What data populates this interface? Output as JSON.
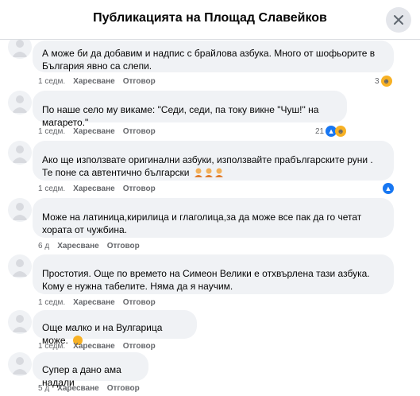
{
  "header": {
    "title": "Публикацията на Площад Славейков"
  },
  "comments": [
    {
      "text": "А може би да добавим и надпис с брайлова азбука. Много от шофьорите в България явно са слепи.",
      "time": "1 седм.",
      "like": "Харесване",
      "reply": "Отговор",
      "reactions": "3",
      "reaction_icons": [
        "haha-icon"
      ]
    },
    {
      "text": "По наше село му викаме: \"Седи, седи, па току викне \"Чуш!\" на магарето.\"",
      "time": "1 седм.",
      "like": "Харесване",
      "reply": "Отговор",
      "reactions": "21",
      "reaction_icons": [
        "like-icon",
        "haha-icon"
      ]
    },
    {
      "text": "Ако ще използвате оригинални азбуки, използвайте прабългарските руни . Те поне са автентично български",
      "time": "1 седм.",
      "like": "Харесване",
      "reply": "Отговор",
      "reactions": "",
      "reaction_icons": [
        "like-icon"
      ]
    },
    {
      "text": "Може на латиница,кирилица и глаголица,за да може все пак да го четат хората от чужбина.",
      "time": "6 д",
      "like": "Харесване",
      "reply": "Отговор",
      "reactions": "",
      "reaction_icons": []
    },
    {
      "text": "Простотия. Още по времето на Симеон Велики е отхвърлена тази азбука. Кому е нужна табелите. Няма да я научим.",
      "time": "1 седм.",
      "like": "Харесване",
      "reply": "Отговор",
      "reactions": "",
      "reaction_icons": []
    },
    {
      "text": "Още малко и на Вулгарица може.",
      "time": "1 седм.",
      "like": "Харесване",
      "reply": "Отговор",
      "reactions": "",
      "reaction_icons": []
    },
    {
      "text": "Супер а дано ама надали",
      "time": "5 д",
      "like": "Харесване",
      "reply": "Отговор",
      "reactions": "",
      "reaction_icons": []
    }
  ],
  "colors": {
    "bubble": "#f0f2f5",
    "meta": "#65676b",
    "like_blue": "#1877f2",
    "haha_yellow": "#f7b125"
  }
}
